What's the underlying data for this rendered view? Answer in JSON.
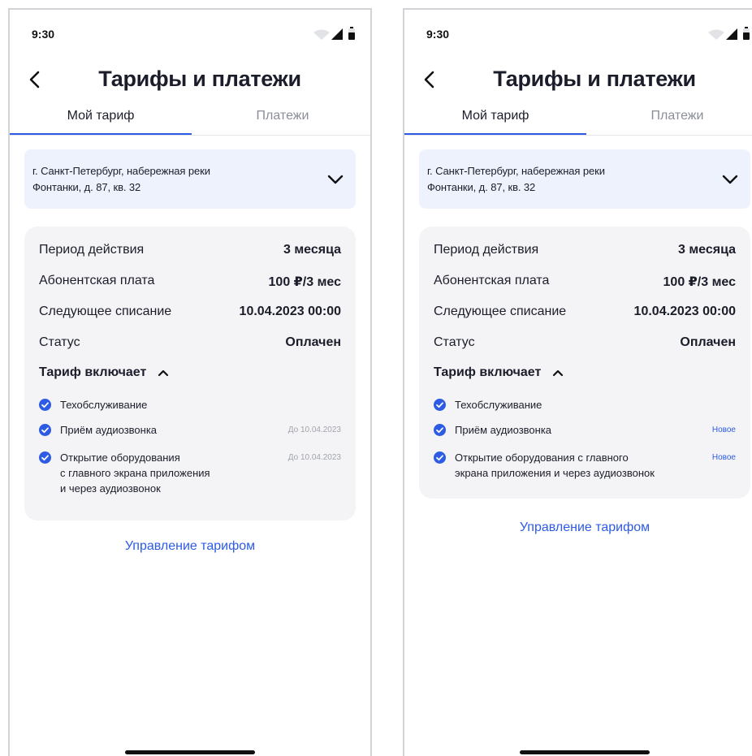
{
  "screens": [
    {
      "status_time": "9:30",
      "title": "Тарифы и платежи",
      "tabs": [
        "Мой тариф",
        "Платежи"
      ],
      "address_line1": "г. Санкт-Петербург, набережная реки",
      "address_line2": "Фонтанки, д. 87, кв. 32",
      "rows": [
        {
          "label": "Период действия",
          "value": "3 месяца"
        },
        {
          "label": "Абонентская плата",
          "value": "100 ₽/3 мес"
        },
        {
          "label": "Следующее списание",
          "value": "10.04.2023 00:00"
        },
        {
          "label": "Статус",
          "value": "Оплачен"
        }
      ],
      "includes_title": "Тариф включает",
      "features": [
        {
          "lines": [
            "Техобслуживание"
          ],
          "note": ""
        },
        {
          "lines": [
            "Приём аудиозвонка"
          ],
          "note": "До 10.04.2023"
        },
        {
          "lines": [
            "Открытие оборудования",
            "с главного экрана приложения",
            "и через аудиозвонок"
          ],
          "note": "До 10.04.2023"
        }
      ],
      "manage_label": "Управление тарифом"
    },
    {
      "status_time": "9:30",
      "title": "Тарифы и платежи",
      "tabs": [
        "Мой тариф",
        "Платежи"
      ],
      "address_line1": "г. Санкт-Петербург, набережная реки",
      "address_line2": "Фонтанки, д. 87, кв. 32",
      "rows": [
        {
          "label": "Период действия",
          "value": "3 месяца"
        },
        {
          "label": "Абонентская плата",
          "value": "100 ₽/3 мес"
        },
        {
          "label": "Следующее списание",
          "value": "10.04.2023 00:00"
        },
        {
          "label": "Статус",
          "value": "Оплачен"
        }
      ],
      "includes_title": "Тариф включает",
      "features": [
        {
          "lines": [
            "Техобслуживание"
          ],
          "note": ""
        },
        {
          "lines": [
            "Приём аудиозвонка"
          ],
          "note": "Новое"
        },
        {
          "lines": [
            "Открытие оборудования с главного",
            "экрана приложения и через аудиозвонок"
          ],
          "note": "Новое"
        }
      ],
      "manage_label": "Управление тарифом"
    }
  ],
  "colors": {
    "accent": "#2d5be3",
    "address_bg": "#eef2fd",
    "card_bg": "#f4f4f6",
    "muted_text": "#a1a4ad"
  },
  "icons": [
    "back-arrow-icon",
    "chevron-down-icon",
    "chevron-up-icon",
    "check-circle-icon",
    "wifi-icon",
    "signal-icon",
    "battery-icon"
  ]
}
